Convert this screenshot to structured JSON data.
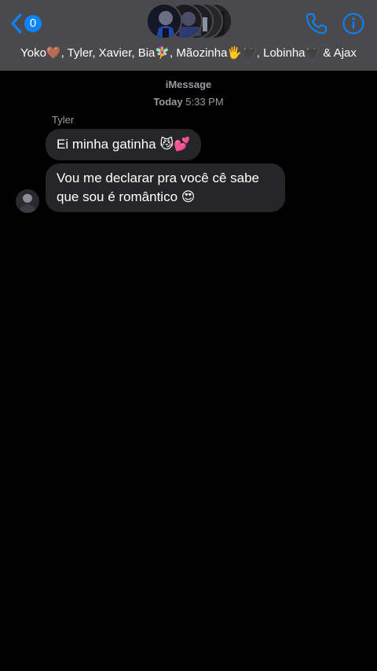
{
  "header": {
    "back_count": "0",
    "group_names": "Yoko🤎, Tyler, Xavier, Bia🧚‍♀️, Mãozinha🖐️🖤, Lobinha🖤 & Ajax"
  },
  "thread": {
    "service": "iMessage",
    "timestamp_day": "Today",
    "timestamp_time": "5:33 PM",
    "sender": "Tyler",
    "messages": [
      {
        "text": "Ei minha gatinha 😼💕"
      },
      {
        "text": "Vou me declarar pra você cê sabe que sou é romântico 😍"
      }
    ]
  },
  "colors": {
    "accent": "#0a84ff",
    "header_bg": "#4a4a4c",
    "bubble_bg": "#262628",
    "secondary_text": "#9a9aa0"
  }
}
